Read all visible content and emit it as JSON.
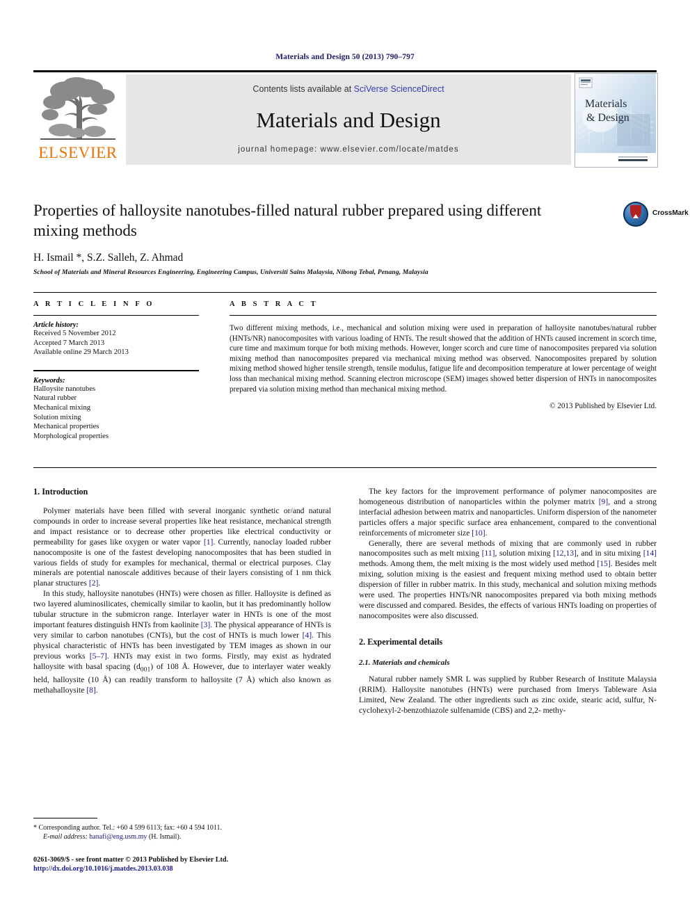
{
  "running_head": "Materials and Design 50 (2013) 790–797",
  "masthead": {
    "contents_prefix": "Contents lists available at ",
    "sciencedirect_link": "SciVerse ScienceDirect",
    "journal_title": "Materials and Design",
    "homepage": "journal homepage: www.elsevier.com/locate/matdes",
    "publisher_wordmark": "ELSEVIER",
    "cover_title_line1": "Materials",
    "cover_title_line2": "& Design"
  },
  "title_block": {
    "title": "Properties of halloysite nanotubes-filled natural rubber prepared using different mixing methods",
    "authors": "H. Ismail *, S.Z. Salleh, Z. Ahmad",
    "affiliation": "School of Materials and Mineral Resources Engineering, Engineering Campus, Universiti Sains Malaysia, Nibong Tebal, Penang, Malaysia",
    "crossmark_label": "CrossMark"
  },
  "article_info": {
    "heading": "A R T I C L E  I N F O",
    "history_label": "Article history:",
    "history": [
      "Received 5 November 2012",
      "Accepted 7 March 2013",
      "Available online 29 March 2013"
    ],
    "keywords_label": "Keywords:",
    "keywords": [
      "Halloysite nanotubes",
      "Natural rubber",
      "Mechanical mixing",
      "Solution mixing",
      "Mechanical properties",
      "Morphological properties"
    ]
  },
  "abstract": {
    "heading": "A B S T R A C T",
    "text": "Two different mixing methods, i.e., mechanical and solution mixing were used in preparation of halloysite nanotubes/natural rubber (HNTs/NR) nanocomposites with various loading of HNTs. The result showed that the addition of HNTs caused increment in scorch time, cure time and maximum torque for both mixing methods. However, longer scorch and cure time of nanocomposites prepared via solution mixing method than nanocomposites prepared via mechanical mixing method was observed. Nanocomposites prepared by solution mixing method showed higher tensile strength, tensile modulus, fatigue life and decomposition temperature at lower percentage of weight loss than mechanical mixing method. Scanning electron microscope (SEM) images showed better dispersion of HNTs in nanocomposites prepared via solution mixing method than mechanical mixing method.",
    "copyright": "© 2013 Published by Elsevier Ltd."
  },
  "body": {
    "left": {
      "section_heading": "1. Introduction",
      "para1_a": "Polymer materials have been filled with several inorganic synthetic or/and natural compounds in order to increase several properties like heat resistance, mechanical strength and impact resistance or to decrease other properties like electrical conductivity or permeability for gases like oxygen or water vapor ",
      "ref1": "[1]",
      "para1_b": ". Currently, nanoclay loaded rubber nanocomposite is one of the fastest developing nanocomposites that has been studied in various fields of study for examples for mechanical, thermal or electrical purposes. Clay minerals are potential nanoscale additives because of their layers consisting of 1 nm thick planar structures ",
      "ref2": "[2]",
      "para1_c": ".",
      "para2_a": "In this study, halloysite nanotubes (HNTs) were chosen as filler. Halloysite is defined as two layered aluminosilicates, chemically similar to kaolin, but it has predominantly hollow tubular structure in the submicron range. Interlayer water in HNTs is one of the most important features distinguish HNTs from kaolinite ",
      "ref3": "[3]",
      "para2_b": ". The physical appearance of HNTs is very similar to carbon nanotubes (CNTs), but the cost of HNTs is much lower ",
      "ref4": "[4]",
      "para2_c": ". This physical characteristic of HNTs has been investigated by TEM images as shown in our previous works ",
      "ref5": "[5–7]",
      "para2_d": ". HNTs may exist in two forms. Firstly, may exist as hydrated halloysite with basal spacing (d",
      "para2_sub": "001",
      "para2_e": ") of 108 Å. However, due to interlayer water weakly held, halloysite (10 Å) can readily transform to halloysite (7 Å) which also known as methahalloysite ",
      "ref6": "[8]",
      "para2_f": "."
    },
    "right": {
      "para1_a": "The key factors for the improvement performance of polymer nanocomposites are homogeneous distribution of nanoparticles within the polymer matrix ",
      "ref9": "[9]",
      "para1_b": ", and a strong interfacial adhesion between matrix and nanoparticles. Uniform dispersion of the nanometer particles offers a major specific surface area enhancement, compared to the conventional reinforcements of micrometer size ",
      "ref10": "[10]",
      "para1_c": ".",
      "para2_a": "Generally, there are several methods of mixing that are commonly used in rubber nanocomposites such as melt mixing ",
      "ref11": "[11]",
      "para2_b": ", solution mixing ",
      "ref1213": "[12,13]",
      "para2_c": ", and in situ mixing ",
      "ref14": "[14]",
      "para2_d": " methods. Among them, the melt mixing is the most widely used method ",
      "ref15": "[15]",
      "para2_e": ". Besides melt mixing, solution mixing is the easiest and frequent mixing method used to obtain better dispersion of filler in rubber matrix. In this study, mechanical and solution mixing methods were used. The properties HNTs/NR nanocomposites prepared via both mixing methods were discussed and compared. Besides, the effects of various HNTs loading on properties of nanocomposites were also discussed.",
      "section_heading": "2. Experimental details",
      "subsection_heading": "2.1. Materials and chemicals",
      "para3": "Natural rubber namely SMR L was supplied by Rubber Research of Institute Malaysia (RRIM). Halloysite nanotubes (HNTs) were purchased from Imerys Tableware Asia Limited, New Zealand. The other ingredients such as zinc oxide, stearic acid, sulfur, N-cyclohexyl-2-benzothiazole sulfenamide (CBS) and 2,2- methy-"
    }
  },
  "footnote": {
    "corresponding": "* Corresponding author. Tel.: +60 4 599 6113; fax: +60 4 594 1011.",
    "email_label": "E-mail address:",
    "email": "hanafi@eng.usm.my",
    "email_suffix": "(H. Ismail)."
  },
  "footer": {
    "issn_line": "0261-3069/$ - see front matter © 2013 Published by Elsevier Ltd.",
    "doi_line": "http://dx.doi.org/10.1016/j.matdes.2013.03.038"
  },
  "colors": {
    "elsevier_orange": "#ec7404",
    "link_blue": "#1a1a8c",
    "sciencedirect_blue": "#3a3ab0",
    "band_gray": "#e6e6e6"
  }
}
